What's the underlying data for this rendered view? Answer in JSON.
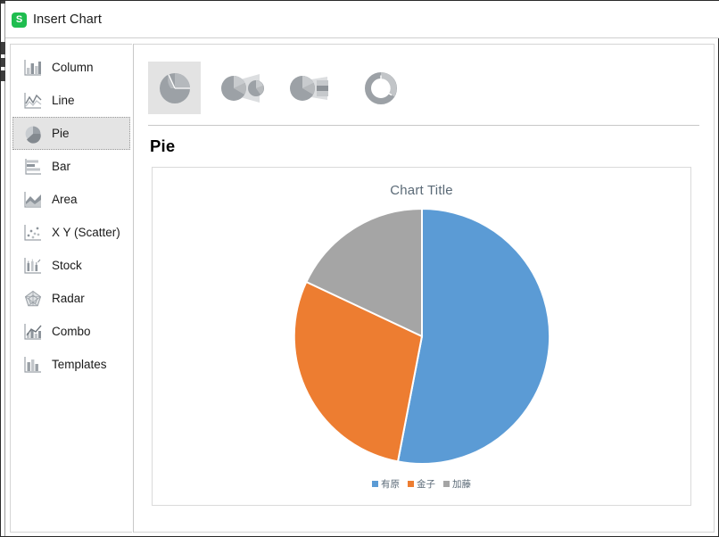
{
  "window": {
    "title": "Insert Chart",
    "app_icon": "spreadsheet-app-icon",
    "app_icon_glyph": "S",
    "app_icon_color": "#1fbd4f"
  },
  "sidebar": {
    "items": [
      {
        "label": "Column",
        "icon": "column-chart-icon",
        "selected": false
      },
      {
        "label": "Line",
        "icon": "line-chart-icon",
        "selected": false
      },
      {
        "label": "Pie",
        "icon": "pie-chart-icon",
        "selected": true
      },
      {
        "label": "Bar",
        "icon": "bar-chart-icon",
        "selected": false
      },
      {
        "label": "Area",
        "icon": "area-chart-icon",
        "selected": false
      },
      {
        "label": "X Y (Scatter)",
        "icon": "scatter-chart-icon",
        "selected": false
      },
      {
        "label": "Stock",
        "icon": "stock-chart-icon",
        "selected": false
      },
      {
        "label": "Radar",
        "icon": "radar-chart-icon",
        "selected": false
      },
      {
        "label": "Combo",
        "icon": "combo-chart-icon",
        "selected": false
      },
      {
        "label": "Templates",
        "icon": "templates-icon",
        "selected": false
      }
    ]
  },
  "main": {
    "heading": "Pie",
    "subtypes": [
      {
        "name": "pie-subtype",
        "selected": true
      },
      {
        "name": "pie-of-pie-subtype",
        "selected": false
      },
      {
        "name": "bar-of-pie-subtype",
        "selected": false
      },
      {
        "name": "doughnut-subtype",
        "selected": false
      }
    ]
  },
  "chart_data": {
    "type": "pie",
    "title": "Chart Title",
    "categories": [
      "有原",
      "金子",
      "加藤"
    ],
    "values": [
      53,
      29,
      18
    ],
    "colors": [
      "#5b9bd5",
      "#ed7d31",
      "#a5a5a5"
    ],
    "legend_position": "bottom",
    "grid": false,
    "xlabel": "",
    "ylabel": "",
    "start_angle_deg": 0,
    "direction": "clockwise",
    "slice_border_color": "#ffffff",
    "title_color": "#5b6a77",
    "legend_text_color": "#5b6a77"
  }
}
